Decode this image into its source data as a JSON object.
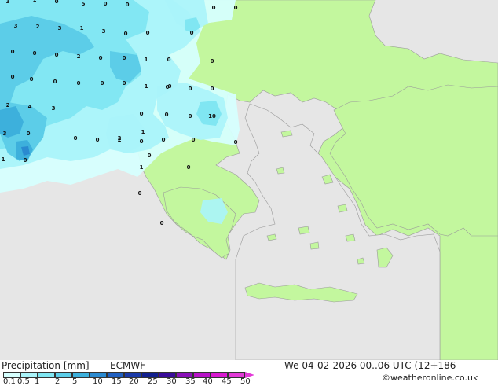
{
  "map": {
    "precip_labels": [
      "5",
      "0",
      "0",
      "0",
      "3",
      "2",
      "3",
      "1",
      "3",
      "0",
      "0",
      "0",
      "0",
      "2",
      "0",
      "1",
      "0",
      "0",
      "0",
      "0",
      "0",
      "0",
      "0",
      "0",
      "0",
      "1",
      "0",
      "0",
      "0",
      "0",
      "0",
      "0",
      "0",
      "0",
      "2",
      "0",
      "0",
      "10",
      "3",
      "2",
      "0",
      "4",
      "3",
      "0",
      "0",
      "1",
      "1",
      "2",
      "0",
      "3",
      "0",
      "0",
      "0",
      "1",
      "0",
      "0",
      "1",
      "0",
      "0",
      "0",
      "0"
    ]
  },
  "footer": {
    "title": "Precipitation [mm]",
    "model": "ECMWF",
    "datetime": "We 04-02-2026 00..06 UTC (12+186",
    "credit": "©weatheronline.co.uk",
    "legend_ticks": [
      "0.1",
      "0.5",
      "1",
      "2",
      "5",
      "10",
      "15",
      "20",
      "25",
      "30",
      "35",
      "40",
      "45",
      "50"
    ],
    "legend_colors": [
      "#d6fffe",
      "#aaf4fa",
      "#80e6f2",
      "#5ccde8",
      "#3db0dc",
      "#2a8ad0",
      "#1f5fc0",
      "#1a3aa8",
      "#12208f",
      "#3a0c9a",
      "#8a10b8",
      "#b812c8",
      "#d818d0",
      "#e33ad8"
    ]
  }
}
